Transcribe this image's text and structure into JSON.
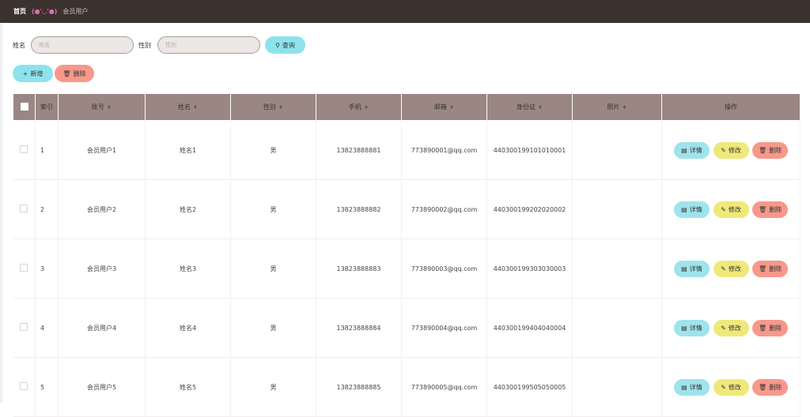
{
  "breadcrumb": {
    "home": "首页",
    "separator": "(●'◡'●)",
    "current": "会员用户"
  },
  "search": {
    "name_label": "姓名",
    "name_placeholder": "姓名",
    "gender_label": "性别",
    "gender_placeholder": "性别",
    "button_label": "查询",
    "button_icon": "search-icon"
  },
  "actions": {
    "add_label": "新增",
    "delete_label": "删除"
  },
  "table": {
    "headers": [
      "索引",
      "账号",
      "姓名",
      "性别",
      "手机",
      "邮箱",
      "身份证",
      "照片",
      "操作"
    ],
    "rows": [
      {
        "index": "1",
        "account": "会员用户1",
        "name": "姓名1",
        "gender": "男",
        "phone": "13823888881",
        "email": "773890001@qq.com",
        "id_card": "440300199101010001",
        "photo": ""
      },
      {
        "index": "2",
        "account": "会员用户2",
        "name": "姓名2",
        "gender": "男",
        "phone": "13823888882",
        "email": "773890002@qq.com",
        "id_card": "440300199202020002",
        "photo": ""
      },
      {
        "index": "3",
        "account": "会员用户3",
        "name": "姓名3",
        "gender": "男",
        "phone": "13823888883",
        "email": "773890003@qq.com",
        "id_card": "440300199303030003",
        "photo": ""
      },
      {
        "index": "4",
        "account": "会员用户4",
        "name": "姓名4",
        "gender": "男",
        "phone": "13823888884",
        "email": "773890004@qq.com",
        "id_card": "440300199404040004",
        "photo": ""
      },
      {
        "index": "5",
        "account": "会员用户5",
        "name": "姓名5",
        "gender": "男",
        "phone": "13823888885",
        "email": "773890005@qq.com",
        "id_card": "440300199505050005",
        "photo": ""
      }
    ],
    "row_actions": {
      "detail": "详情",
      "edit": "修改",
      "delete": "删除"
    }
  },
  "colors": {
    "topbar": "#3b3230",
    "header": "#9a8783",
    "cyan": "#8de3ec",
    "red": "#f7988b",
    "yellow": "#efe97a"
  }
}
